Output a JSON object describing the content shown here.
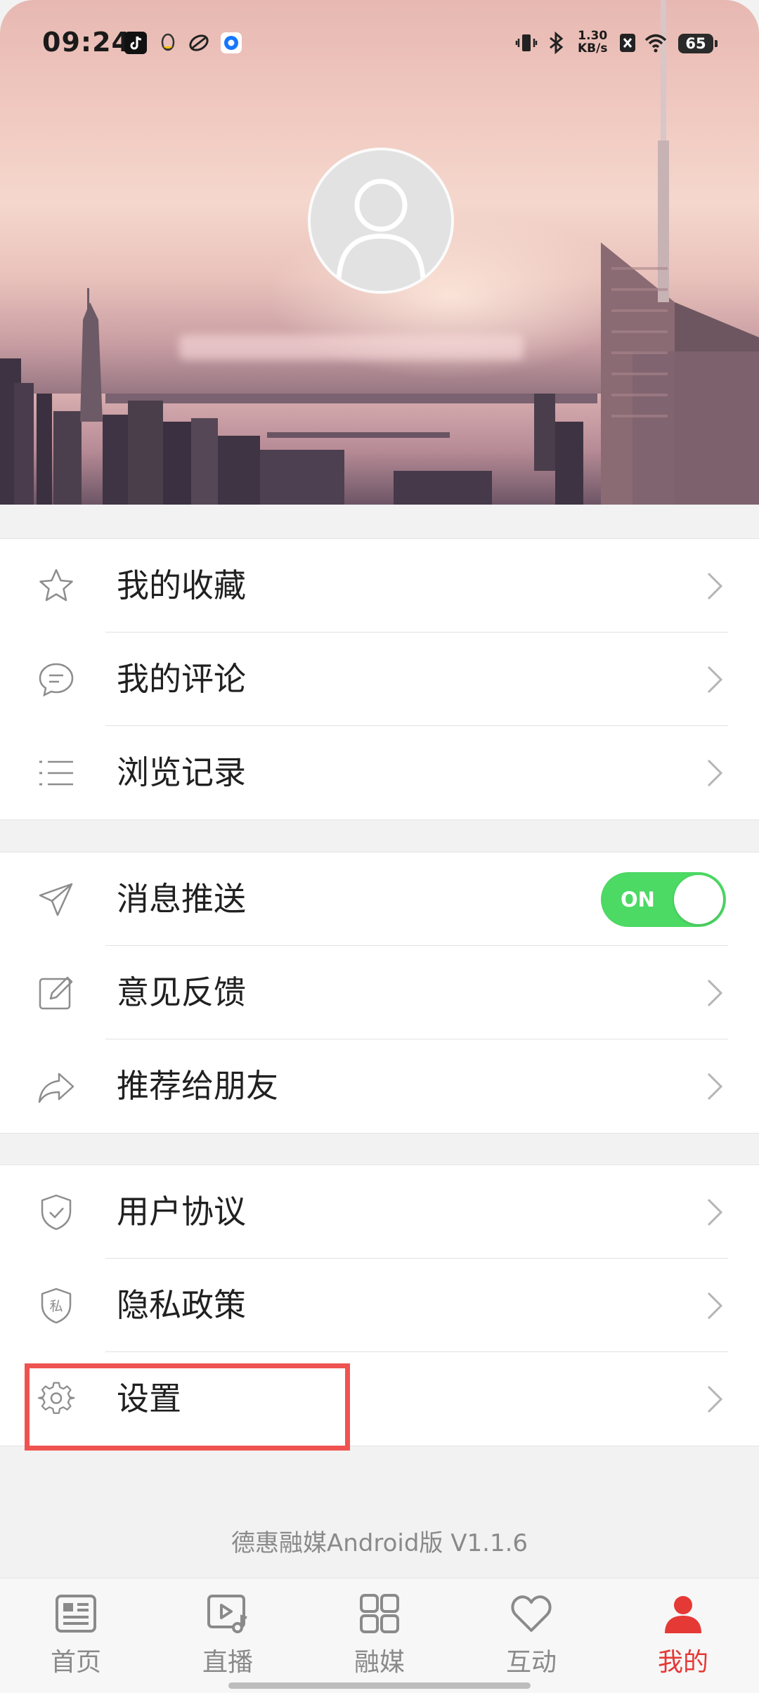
{
  "status_bar": {
    "time": "09:24",
    "net_speed_value": "1.30",
    "net_speed_unit": "KB/s",
    "battery": "65"
  },
  "profile": {
    "avatar_icon": "user-placeholder-icon"
  },
  "menu": {
    "favorites": "我的收藏",
    "comments": "我的评论",
    "history": "浏览记录",
    "push": "消息推送",
    "push_toggle": "ON",
    "feedback": "意见反馈",
    "share": "推荐给朋友",
    "user_agreement": "用户协议",
    "privacy": "隐私政策",
    "privacy_badge": "私",
    "settings": "设置"
  },
  "footer": {
    "version": "德惠融媒Android版 V1.1.6"
  },
  "bottom_nav": {
    "items": [
      {
        "label": "首页",
        "icon": "news-icon"
      },
      {
        "label": "直播",
        "icon": "live-icon"
      },
      {
        "label": "融媒",
        "icon": "grid-icon"
      },
      {
        "label": "互动",
        "icon": "heart-icon"
      },
      {
        "label": "我的",
        "icon": "person-icon"
      }
    ],
    "active_index": 4
  },
  "colors": {
    "accent": "#e53935",
    "toggle_on": "#4cd964",
    "highlight": "#ef5350"
  }
}
